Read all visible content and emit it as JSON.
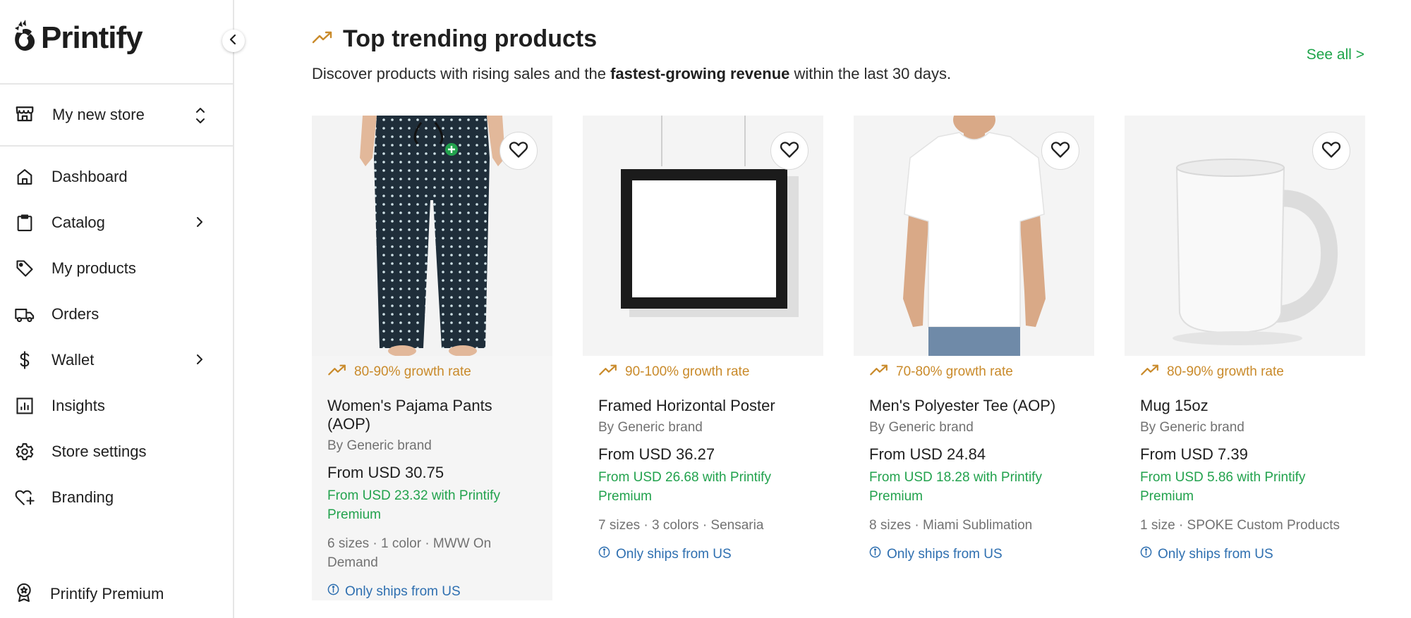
{
  "app": {
    "logo_text": "Printify"
  },
  "sidebar": {
    "store_name": "My new store",
    "items": [
      {
        "label": "Dashboard",
        "icon": "home-icon",
        "has_chevron": false
      },
      {
        "label": "Catalog",
        "icon": "clipboard-icon",
        "has_chevron": true
      },
      {
        "label": "My products",
        "icon": "tag-icon",
        "has_chevron": false
      },
      {
        "label": "Orders",
        "icon": "truck-icon",
        "has_chevron": false
      },
      {
        "label": "Wallet",
        "icon": "dollar-icon",
        "has_chevron": true
      },
      {
        "label": "Insights",
        "icon": "chart-icon",
        "has_chevron": false
      },
      {
        "label": "Store settings",
        "icon": "gear-icon",
        "has_chevron": false
      },
      {
        "label": "Branding",
        "icon": "heart-plus-icon",
        "has_chevron": false
      }
    ],
    "premium_label": "Printify Premium"
  },
  "main": {
    "title": "Top trending products",
    "subtitle_before": "Discover products with rising sales and the ",
    "subtitle_bold": "fastest-growing revenue",
    "subtitle_after": " within the last 30 days.",
    "see_all": "See all >",
    "products": [
      {
        "growth": "80-90% growth rate",
        "name": "Women's Pajama Pants (AOP)",
        "brand": "By Generic brand",
        "price": "From USD 30.75",
        "premium_price": "From USD 23.32 with Printify Premium",
        "meta": "6 sizes · 1 color · MWW On Demand",
        "ships": "Only ships from US",
        "image": "pajama-pants"
      },
      {
        "growth": "90-100% growth rate",
        "name": "Framed Horizontal Poster",
        "brand": "By Generic brand",
        "price": "From USD 36.27",
        "premium_price": "From USD 26.68 with Printify Premium",
        "meta": "7 sizes · 3 colors · Sensaria",
        "ships": "Only ships from US",
        "image": "framed-poster"
      },
      {
        "growth": "70-80% growth rate",
        "name": "Men's Polyester Tee (AOP)",
        "brand": "By Generic brand",
        "price": "From USD 24.84",
        "premium_price": "From USD 18.28 with Printify Premium",
        "meta": "8 sizes · Miami Sublimation",
        "ships": "Only ships from US",
        "image": "white-tee"
      },
      {
        "growth": "80-90% growth rate",
        "name": "Mug 15oz",
        "brand": "By Generic brand",
        "price": "From USD 7.39",
        "premium_price": "From USD 5.86 with Printify Premium",
        "meta": "1 size · SPOKE Custom Products",
        "ships": "Only ships from US",
        "image": "white-mug"
      }
    ]
  },
  "colors": {
    "accent_green": "#1ea44a",
    "growth_orange": "#c98a2a",
    "link_blue": "#2e6fb0"
  }
}
